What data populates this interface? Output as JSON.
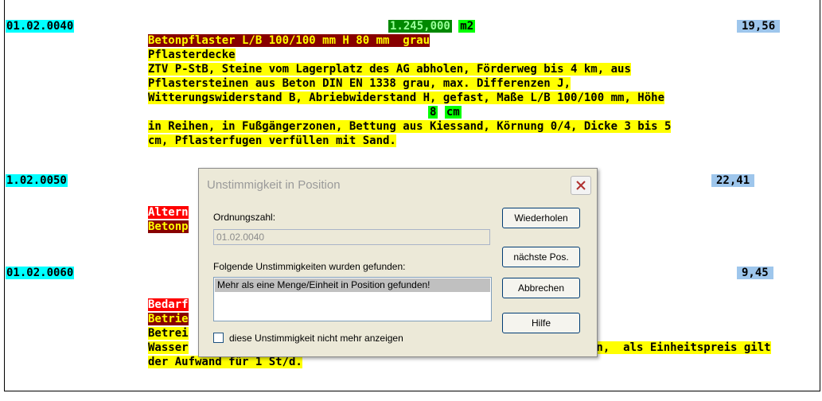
{
  "document": {
    "pos1": {
      "oz": "01.02.0040",
      "quantity": "1.245,000",
      "unit": "m2",
      "price": "19,56",
      "title": "Betonpflaster L/B 100/100 mm H 80 mm  grau",
      "subtitle": "Pflasterdecke",
      "desc1": "ZTV P-StB, Steine vom Lagerplatz des AG abholen, Förderweg bis 4 km, aus",
      "desc2": "Pflastersteinen aus Beton DIN EN 1338 grau, max. Differenzen J,",
      "desc3": "Witterungswiderstand B, Abriebwiderstand H, gefast, Maße L/B 100/100 mm, Höhe",
      "desc4_num": "8",
      "desc4_unit": "cm",
      "desc5": "in Reihen, in Fußgängerzonen, Bettung aus Kiessand, Körnung 0/4, Dicke 3 bis 5",
      "desc6": "cm, Pflasterfugen verfüllen mit Sand."
    },
    "pos2": {
      "oz": "1.02.0050",
      "price": "22,41",
      "line1": "Altern",
      "line2": "Betonp"
    },
    "pos3": {
      "oz": "01.02.0060",
      "price": "9,45",
      "line1": "Bedarf",
      "line2": "Betrie",
      "line3": "Betrei",
      "line4_start": "Wasser",
      "line4_end": "en,  als Einheitspreis gilt",
      "line5": "der Aufwand für 1 St/d."
    }
  },
  "dialog": {
    "title": "Unstimmigkeit in Position",
    "oz_label": "Ordnungszahl:",
    "oz_value": "01.02.0040",
    "issues_label": "Folgende Unstimmigkeiten wurden gefunden:",
    "issues": [
      "Mehr als eine Menge/Einheit in Position gefunden!"
    ],
    "checkbox_label": "diese Unstimmigkeit nicht mehr anzeigen",
    "buttons": {
      "repeat": "Wiederholen",
      "next": "nächste Pos.",
      "cancel": "Abbrechen",
      "help": "Hilfe"
    }
  }
}
